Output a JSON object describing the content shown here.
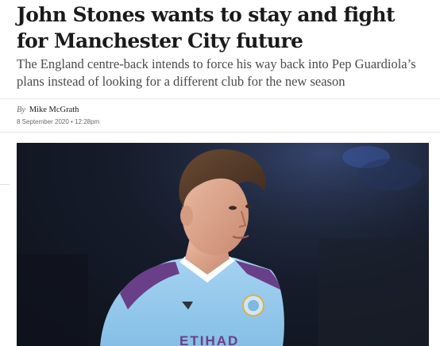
{
  "article": {
    "headline": "John Stones wants to stay and fight for Manchester City future",
    "standfirst": "The England centre-back intends to force his way back into Pep Guardiola’s plans instead of looking for a different club for the new season",
    "byline_prefix": "By",
    "author": "Mike McGrath",
    "date": "8 September 2020 • 12:28pm"
  },
  "photo": {
    "subject": "footballer-in-sky-blue-shirt",
    "shirt_text": "ETIHAD",
    "colors": {
      "shirt": "#8fc3e8",
      "trim": "#6a3f8a",
      "background": "#141a27"
    }
  }
}
